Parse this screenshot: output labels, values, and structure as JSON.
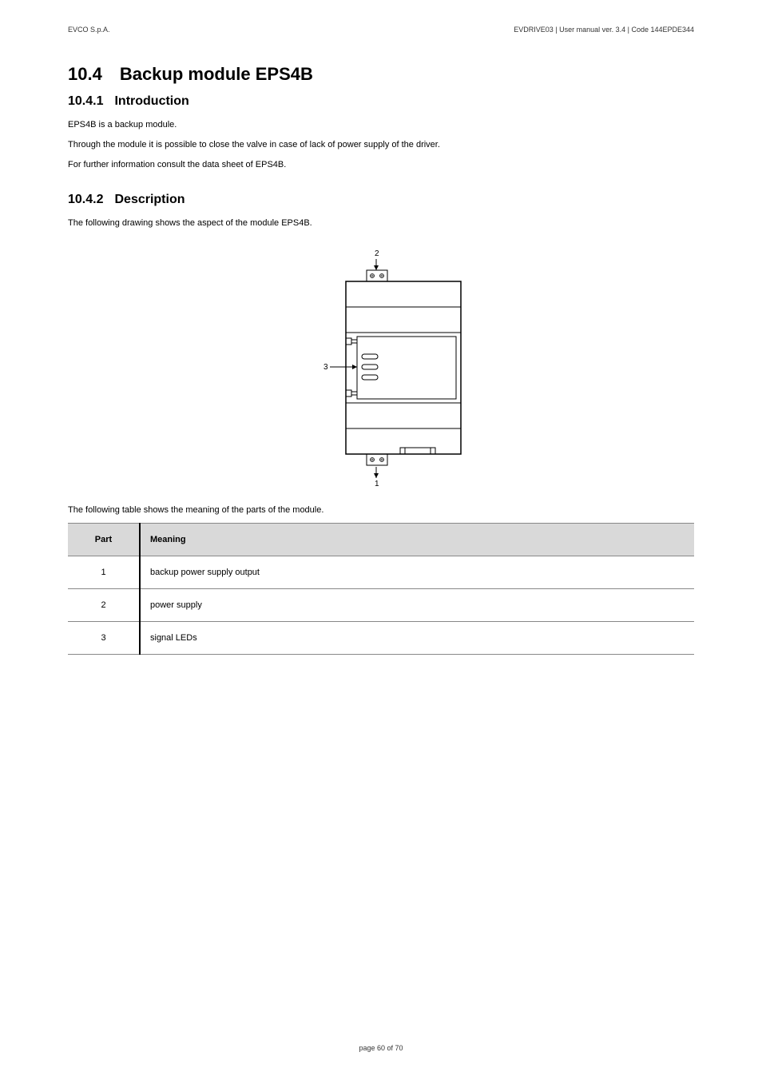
{
  "header": {
    "left": "EVCO S.p.A.",
    "right": "EVDRIVE03 | User manual ver. 3.4 | Code 144EPDE344"
  },
  "section": {
    "number": "10.4",
    "title": "Backup module EPS4B"
  },
  "subsection1": {
    "number": "10.4.1",
    "title": "Introduction",
    "paragraphs": {
      "p1": "EPS4B is a backup module.",
      "p2": "Through the module it is possible to close the valve in case of lack of power supply of the driver.",
      "p3": "For further information consult the data sheet of EPS4B."
    }
  },
  "subsection2": {
    "number": "10.4.2",
    "title": "Description",
    "paragraph": "The following drawing shows the aspect of the module EPS4B."
  },
  "diagram": {
    "labels": {
      "top": "2",
      "left": "3",
      "bottom": "1"
    }
  },
  "table": {
    "caption": "The following table shows the meaning of the parts of the module.",
    "headers": {
      "part": "Part",
      "meaning": "Meaning"
    },
    "rows": [
      {
        "part": "1",
        "meaning": "backup power supply output"
      },
      {
        "part": "2",
        "meaning": "power supply"
      },
      {
        "part": "3",
        "meaning": "signal LEDs"
      }
    ]
  },
  "footer": "page 60 of 70"
}
